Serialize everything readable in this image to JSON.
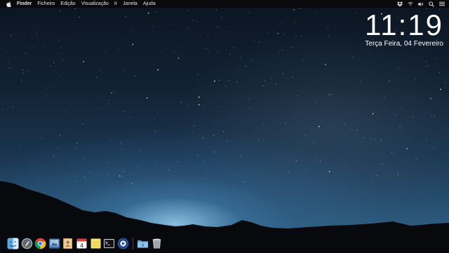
{
  "menubar": {
    "apple_icon": "apple-icon",
    "items": [
      "Finder",
      "Ficheiro",
      "Edição",
      "Visualização",
      "Ir",
      "Janela",
      "Ajuda"
    ],
    "status_icons": [
      "dropbox-icon",
      "wifi-icon",
      "volume-icon",
      "search-icon",
      "list-icon"
    ]
  },
  "clock": {
    "time": "11:19",
    "date": "Terça Feira, 04 Fevereiro"
  },
  "dock": {
    "apps": [
      "finder-icon",
      "launchpad-icon",
      "chrome-icon",
      "preview-icon",
      "contacts-icon",
      "calendar-icon",
      "notes-icon",
      "terminal-icon",
      "quicktime-icon"
    ],
    "calendar_day": "4",
    "right": [
      "downloads-folder-icon",
      "trash-icon"
    ]
  },
  "colors": {
    "menubar_bg": "#0a0a0c",
    "menubar_text": "#e6e6e6",
    "clock_text": "#ffffff"
  }
}
